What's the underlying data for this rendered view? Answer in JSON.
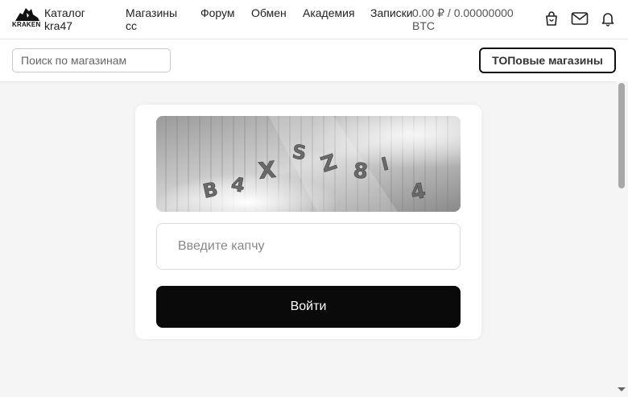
{
  "header": {
    "logo_text": "KRAKEN",
    "brand_title": "Каталог kra47",
    "nav": {
      "shops": "Магазины cc",
      "forum": "Форум",
      "exchange": "Обмен",
      "academy": "Академия",
      "notes": "Записки"
    },
    "balance": "0.00 ₽ / 0.00000000 BTC",
    "icons": [
      "bag-icon",
      "mail-icon",
      "bell-icon"
    ]
  },
  "subbar": {
    "search_placeholder": "Поиск по магазинам",
    "top_button_label": "ТОПовые магазины"
  },
  "login_card": {
    "captcha_text": "B4XSZ8I4",
    "captcha_placeholder": "Введите капчу",
    "submit_label": "Войти"
  }
}
